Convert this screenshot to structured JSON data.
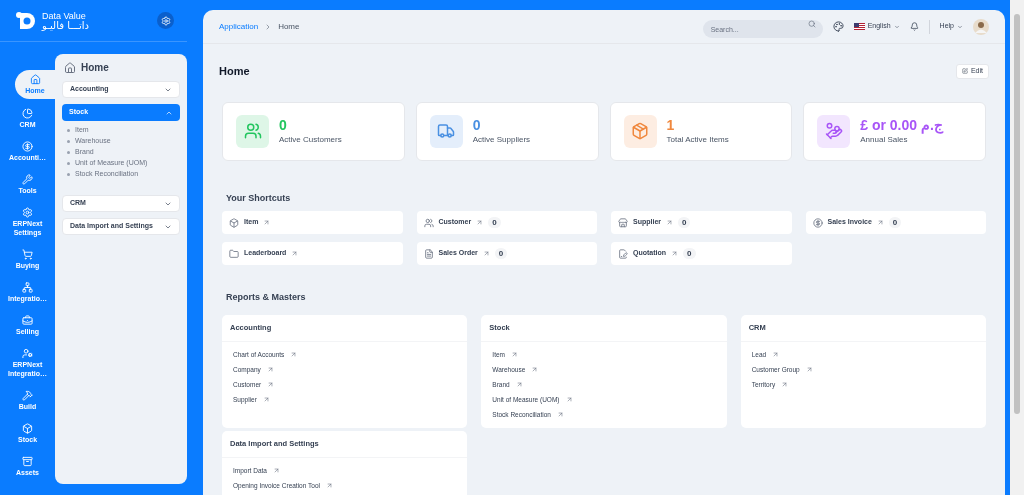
{
  "brand": {
    "name": "Data Value",
    "name_ar": "داتـــا فاليـو"
  },
  "rail": [
    {
      "label": "Home",
      "selected": true
    },
    {
      "label": "CRM",
      "selected": false
    },
    {
      "label": "Accounti…",
      "selected": false
    },
    {
      "label": "Tools",
      "selected": false
    },
    {
      "label": "ERPNext Settings",
      "selected": false
    },
    {
      "label": "Buying",
      "selected": false
    },
    {
      "label": "Integratio…",
      "selected": false
    },
    {
      "label": "Selling",
      "selected": false
    },
    {
      "label": "ERPNext Integratio…",
      "selected": false
    },
    {
      "label": "Build",
      "selected": false
    },
    {
      "label": "Stock",
      "selected": false
    },
    {
      "label": "Assets",
      "selected": false
    }
  ],
  "sidebar": {
    "title": "Home",
    "sections": [
      {
        "label": "Accounting",
        "expanded": false
      },
      {
        "label": "Stock",
        "expanded": true,
        "items": [
          "Item",
          "Warehouse",
          "Brand",
          "Unit of Measure (UOM)",
          "Stock Reconciliation"
        ]
      },
      {
        "label": "CRM",
        "expanded": false
      },
      {
        "label": "Data Import and Settings",
        "expanded": false
      }
    ]
  },
  "topbar": {
    "breadcrumbs": [
      "Application",
      "Home"
    ],
    "search": {
      "placeholder": "Search..."
    },
    "language": "English",
    "help": "Help"
  },
  "page": {
    "title": "Home",
    "edit": "Edit"
  },
  "stats": [
    {
      "value": "0",
      "label": "Active Customers",
      "color": "#22c55e"
    },
    {
      "value": "0",
      "label": "Active Suppliers",
      "color": "#4a90e2"
    },
    {
      "value": "1",
      "label": "Total Active Items",
      "color": "#f0883e"
    },
    {
      "value": "£ or 0.00 ج.م",
      "label": "Annual Sales",
      "color": "#a855f7"
    }
  ],
  "shortcuts": {
    "title": "Your Shortcuts",
    "items": [
      {
        "label": "Item"
      },
      {
        "label": "Customer",
        "count": "0"
      },
      {
        "label": "Supplier",
        "count": "0"
      },
      {
        "label": "Sales Invoice",
        "count": "0"
      },
      {
        "label": "Leaderboard"
      },
      {
        "label": "Sales Order",
        "count": "0"
      },
      {
        "label": "Quotation",
        "count": "0"
      }
    ]
  },
  "reports": {
    "title": "Reports & Masters",
    "cards": [
      {
        "title": "Accounting",
        "links": [
          "Chart of Accounts",
          "Company",
          "Customer",
          "Supplier"
        ]
      },
      {
        "title": "Stock",
        "links": [
          "Item",
          "Warehouse",
          "Brand",
          "Unit of Measure (UOM)",
          "Stock Reconciliation"
        ]
      },
      {
        "title": "CRM",
        "links": [
          "Lead",
          "Customer Group",
          "Territory"
        ]
      },
      {
        "title": "Data Import and Settings",
        "links": [
          "Import Data",
          "Opening Invoice Creation Tool"
        ]
      }
    ]
  }
}
